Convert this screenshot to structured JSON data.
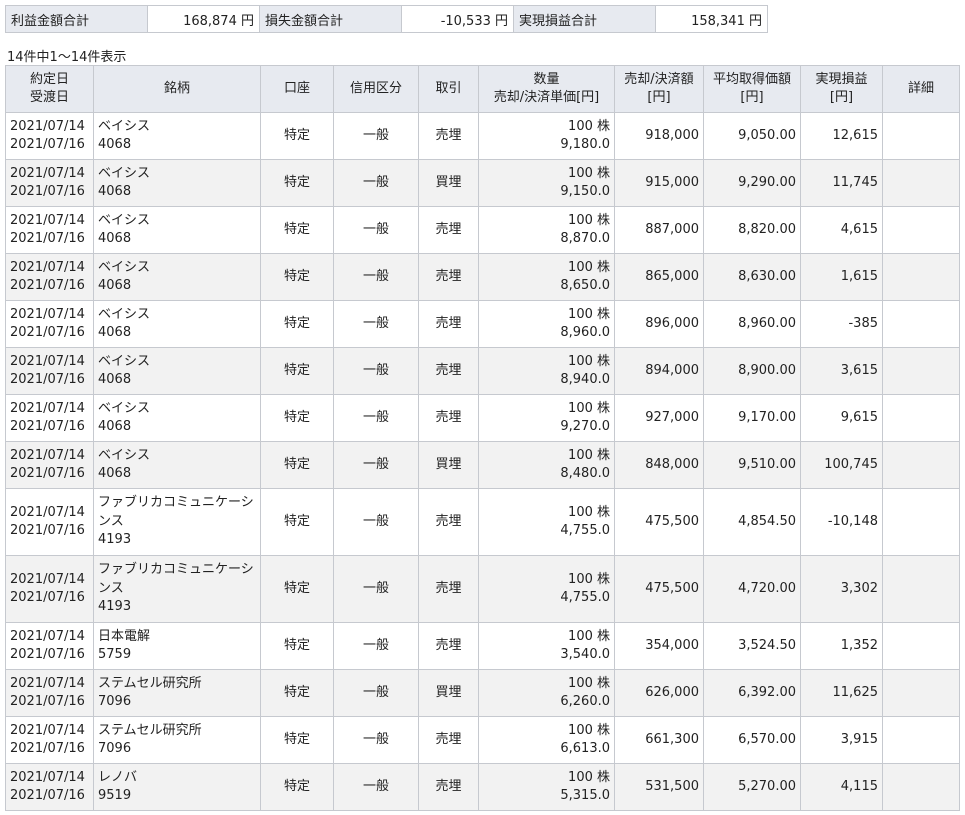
{
  "summary": [
    {
      "label": "利益金額合計",
      "value": "168,874 円"
    },
    {
      "label": "損失金額合計",
      "value": "-10,533 円"
    },
    {
      "label": "実現損益合計",
      "value": "158,341 円"
    }
  ],
  "count_text": "14件中1～14件表示",
  "headers": {
    "date_a": "約定日",
    "date_b": "受渡日",
    "name": "銘柄",
    "account": "口座",
    "credit": "信用区分",
    "trade": "取引",
    "qty_a": "数量",
    "qty_b": "売却/決済単価[円]",
    "amount_a": "売却/決済額",
    "amount_b": "[円]",
    "avg_a": "平均取得価額",
    "avg_b": "[円]",
    "pl_a": "実現損益",
    "pl_b": "[円]",
    "detail": "詳細"
  },
  "rows": [
    {
      "date1": "2021/07/14",
      "date2": "2021/07/16",
      "name_lines": [
        "ベイシス",
        "4068"
      ],
      "account": "特定",
      "credit": "一般",
      "trade": "売埋",
      "qty": "100 株",
      "price": "9,180.0",
      "amount": "918,000",
      "avg": "9,050.00",
      "pl": "12,615"
    },
    {
      "date1": "2021/07/14",
      "date2": "2021/07/16",
      "name_lines": [
        "ベイシス",
        "4068"
      ],
      "account": "特定",
      "credit": "一般",
      "trade": "買埋",
      "qty": "100 株",
      "price": "9,150.0",
      "amount": "915,000",
      "avg": "9,290.00",
      "pl": "11,745"
    },
    {
      "date1": "2021/07/14",
      "date2": "2021/07/16",
      "name_lines": [
        "ベイシス",
        "4068"
      ],
      "account": "特定",
      "credit": "一般",
      "trade": "売埋",
      "qty": "100 株",
      "price": "8,870.0",
      "amount": "887,000",
      "avg": "8,820.00",
      "pl": "4,615"
    },
    {
      "date1": "2021/07/14",
      "date2": "2021/07/16",
      "name_lines": [
        "ベイシス",
        "4068"
      ],
      "account": "特定",
      "credit": "一般",
      "trade": "売埋",
      "qty": "100 株",
      "price": "8,650.0",
      "amount": "865,000",
      "avg": "8,630.00",
      "pl": "1,615"
    },
    {
      "date1": "2021/07/14",
      "date2": "2021/07/16",
      "name_lines": [
        "ベイシス",
        "4068"
      ],
      "account": "特定",
      "credit": "一般",
      "trade": "売埋",
      "qty": "100 株",
      "price": "8,960.0",
      "amount": "896,000",
      "avg": "8,960.00",
      "pl": "-385"
    },
    {
      "date1": "2021/07/14",
      "date2": "2021/07/16",
      "name_lines": [
        "ベイシス",
        "4068"
      ],
      "account": "特定",
      "credit": "一般",
      "trade": "売埋",
      "qty": "100 株",
      "price": "8,940.0",
      "amount": "894,000",
      "avg": "8,900.00",
      "pl": "3,615"
    },
    {
      "date1": "2021/07/14",
      "date2": "2021/07/16",
      "name_lines": [
        "ベイシス",
        "4068"
      ],
      "account": "特定",
      "credit": "一般",
      "trade": "売埋",
      "qty": "100 株",
      "price": "9,270.0",
      "amount": "927,000",
      "avg": "9,170.00",
      "pl": "9,615"
    },
    {
      "date1": "2021/07/14",
      "date2": "2021/07/16",
      "name_lines": [
        "ベイシス",
        "4068"
      ],
      "account": "特定",
      "credit": "一般",
      "trade": "買埋",
      "qty": "100 株",
      "price": "8,480.0",
      "amount": "848,000",
      "avg": "9,510.00",
      "pl": "100,745"
    },
    {
      "date1": "2021/07/14",
      "date2": "2021/07/16",
      "name_lines": [
        "ファブリカコミュニケーショ",
        "ンス",
        "4193"
      ],
      "account": "特定",
      "credit": "一般",
      "trade": "売埋",
      "qty": "100 株",
      "price": "4,755.0",
      "amount": "475,500",
      "avg": "4,854.50",
      "pl": "-10,148"
    },
    {
      "date1": "2021/07/14",
      "date2": "2021/07/16",
      "name_lines": [
        "ファブリカコミュニケーショ",
        "ンス",
        "4193"
      ],
      "account": "特定",
      "credit": "一般",
      "trade": "売埋",
      "qty": "100 株",
      "price": "4,755.0",
      "amount": "475,500",
      "avg": "4,720.00",
      "pl": "3,302"
    },
    {
      "date1": "2021/07/14",
      "date2": "2021/07/16",
      "name_lines": [
        "日本電解",
        "5759"
      ],
      "account": "特定",
      "credit": "一般",
      "trade": "売埋",
      "qty": "100 株",
      "price": "3,540.0",
      "amount": "354,000",
      "avg": "3,524.50",
      "pl": "1,352"
    },
    {
      "date1": "2021/07/14",
      "date2": "2021/07/16",
      "name_lines": [
        "ステムセル研究所",
        "7096"
      ],
      "account": "特定",
      "credit": "一般",
      "trade": "買埋",
      "qty": "100 株",
      "price": "6,260.0",
      "amount": "626,000",
      "avg": "6,392.00",
      "pl": "11,625"
    },
    {
      "date1": "2021/07/14",
      "date2": "2021/07/16",
      "name_lines": [
        "ステムセル研究所",
        "7096"
      ],
      "account": "特定",
      "credit": "一般",
      "trade": "売埋",
      "qty": "100 株",
      "price": "6,613.0",
      "amount": "661,300",
      "avg": "6,570.00",
      "pl": "3,915"
    },
    {
      "date1": "2021/07/14",
      "date2": "2021/07/16",
      "name_lines": [
        "レノバ",
        "9519"
      ],
      "account": "特定",
      "credit": "一般",
      "trade": "売埋",
      "qty": "100 株",
      "price": "5,315.0",
      "amount": "531,500",
      "avg": "5,270.00",
      "pl": "4,115"
    }
  ]
}
